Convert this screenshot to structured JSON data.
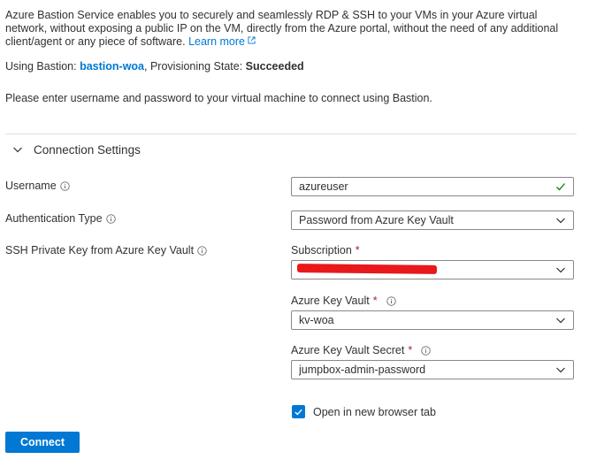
{
  "intro": {
    "text": "Azure Bastion Service enables you to securely and seamlessly RDP & SSH to your VMs in your Azure virtual network, without exposing a public IP on the VM, directly from the Azure portal, without the need of any additional client/agent or any piece of software.",
    "learn_more": "Learn more"
  },
  "bastion": {
    "using_label": "Using Bastion:",
    "name": "bastion-woa",
    "state_label": ", Provisioning State:",
    "state": "Succeeded"
  },
  "instruction": "Please enter username and password to your virtual machine to connect using Bastion.",
  "section": {
    "title": "Connection Settings"
  },
  "form": {
    "username": {
      "label": "Username",
      "value": "azureuser"
    },
    "auth_type": {
      "label": "Authentication Type",
      "value": "Password from Azure Key Vault"
    },
    "ssh_key": {
      "label": "SSH Private Key from Azure Key Vault"
    },
    "subscription": {
      "label": "Subscription",
      "required": "*"
    },
    "key_vault": {
      "label": "Azure Key Vault",
      "required": "*",
      "value": "kv-woa"
    },
    "secret": {
      "label": "Azure Key Vault Secret",
      "required": "*",
      "value": "jumpbox-admin-password"
    },
    "new_tab": {
      "label": "Open in new browser tab",
      "checked": true
    }
  },
  "connect_label": "Connect",
  "colors": {
    "accent": "#0078d4",
    "required": "#a4262c",
    "valid": "#107c10",
    "redaction": "#e8181b"
  }
}
